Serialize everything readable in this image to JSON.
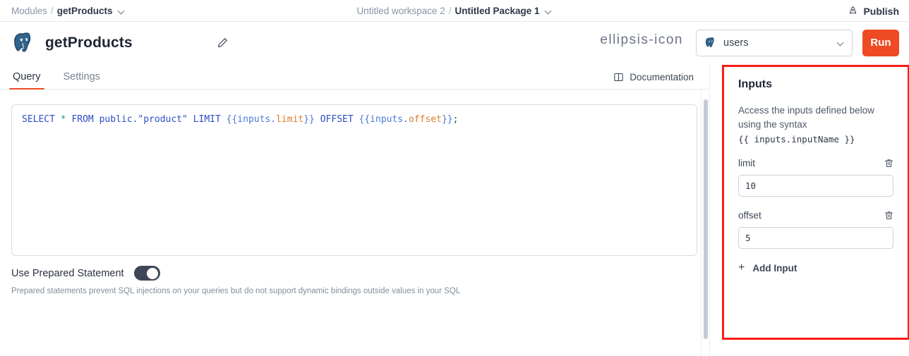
{
  "topbar": {
    "module_label": "Modules",
    "separator": "/",
    "query_name": "getProducts",
    "workspace": "Untitled workspace 2",
    "package": "Untitled Package 1",
    "publish_label": "Publish",
    "publish_icon": "rocket-icon",
    "chevron_icon": "chevron-down-icon"
  },
  "header": {
    "logo_icon": "postgresql-elephant-icon",
    "title": "getProducts",
    "edit_icon": "pencil-icon",
    "more_icon": "ellipsis-icon",
    "resource": {
      "icon": "postgresql-elephant-icon",
      "name": "users",
      "chevron_icon": "chevron-down-icon"
    },
    "run_label": "Run",
    "run_color": "#ee4a23"
  },
  "tabs": {
    "items": [
      {
        "label": "Query",
        "active": true
      },
      {
        "label": "Settings",
        "active": false
      }
    ],
    "documentation_label": "Documentation",
    "documentation_icon": "book-icon",
    "active_indicator_color": "#ee4a23"
  },
  "editor": {
    "sql_tokens": [
      {
        "text": "SELECT",
        "type": "keyword"
      },
      {
        "text": " ",
        "type": "plain"
      },
      {
        "text": "*",
        "type": "star"
      },
      {
        "text": " ",
        "type": "plain"
      },
      {
        "text": "FROM",
        "type": "keyword"
      },
      {
        "text": " ",
        "type": "plain"
      },
      {
        "text": "public.",
        "type": "keyword"
      },
      {
        "text": "\"product\"",
        "type": "string"
      },
      {
        "text": " ",
        "type": "plain"
      },
      {
        "text": "LIMIT",
        "type": "keyword"
      },
      {
        "text": " ",
        "type": "plain"
      },
      {
        "text": "{{inputs.",
        "type": "handlebar"
      },
      {
        "text": "limit",
        "type": "handlebar-value"
      },
      {
        "text": "}}",
        "type": "handlebar"
      },
      {
        "text": " ",
        "type": "plain"
      },
      {
        "text": "OFFSET",
        "type": "keyword"
      },
      {
        "text": " ",
        "type": "plain"
      },
      {
        "text": "{{inputs.",
        "type": "handlebar"
      },
      {
        "text": "offset",
        "type": "handlebar-value"
      },
      {
        "text": "}}",
        "type": "handlebar"
      },
      {
        "text": ";",
        "type": "plain"
      }
    ],
    "sql_text": "SELECT * FROM public.\"product\" LIMIT {{inputs.limit}} OFFSET {{inputs.offset}};"
  },
  "prepared_statement": {
    "label": "Use Prepared Statement",
    "enabled": true,
    "help": "Prepared statements prevent SQL injections on your queries but do not support dynamic bindings outside values in your SQL"
  },
  "inputs_panel": {
    "title": "Inputs",
    "description": "Access the inputs defined below using the syntax",
    "syntax_example": "{{ inputs.inputName }}",
    "highlight_color": "#fb1b13",
    "fields": [
      {
        "name": "limit",
        "value": "10",
        "delete_icon": "trash-icon"
      },
      {
        "name": "offset",
        "value": "5",
        "delete_icon": "trash-icon"
      }
    ],
    "add_input_label": "Add Input",
    "add_input_icon": "plus-icon"
  }
}
